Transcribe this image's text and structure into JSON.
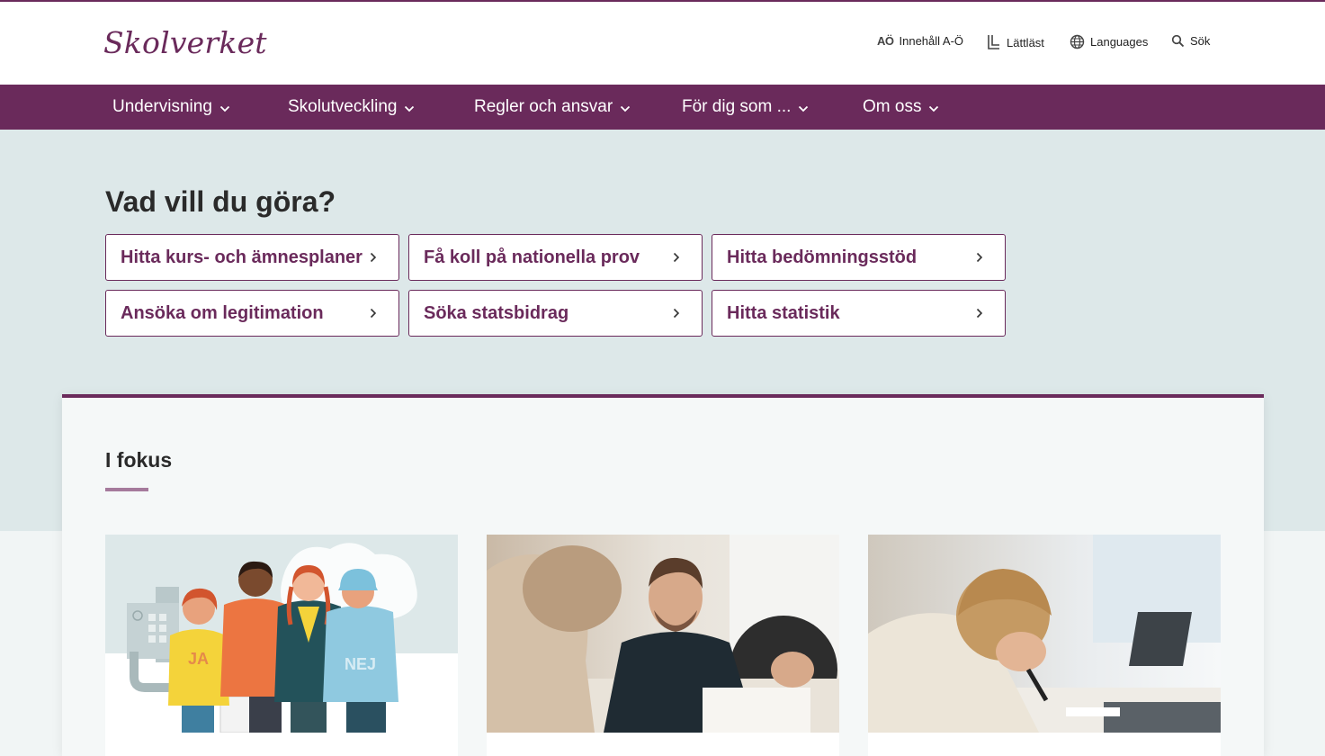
{
  "header": {
    "logo": "Skolverket",
    "utility": [
      {
        "icon": "az-icon",
        "icon_text": "AÖ",
        "label": "Innehåll A-Ö"
      },
      {
        "icon": "easy-read-icon",
        "label": "Lättläst"
      },
      {
        "icon": "globe-icon",
        "label": "Languages"
      },
      {
        "icon": "search-icon",
        "label": "Sök"
      }
    ]
  },
  "nav": {
    "items": [
      {
        "label": "Undervisning"
      },
      {
        "label": "Skolutveckling"
      },
      {
        "label": "Regler och ansvar"
      },
      {
        "label": "För dig som ..."
      },
      {
        "label": "Om oss"
      }
    ]
  },
  "hero": {
    "title": "Vad vill du göra?",
    "links": [
      {
        "label": "Hitta kurs- och ämnesplaner"
      },
      {
        "label": "Få koll på nationella prov"
      },
      {
        "label": "Hitta bedömningsstöd"
      },
      {
        "label": "Ansöka om legitimation"
      },
      {
        "label": "Söka statsbidrag"
      },
      {
        "label": "Hitta statistik"
      }
    ]
  },
  "focus": {
    "title": "I fokus",
    "illustration_texts": {
      "ja": "JA",
      "nej": "NEJ"
    }
  },
  "colors": {
    "brand": "#6a2a5b",
    "hero_bg": "#dde8e9",
    "card_bg": "#f5f8f8"
  }
}
